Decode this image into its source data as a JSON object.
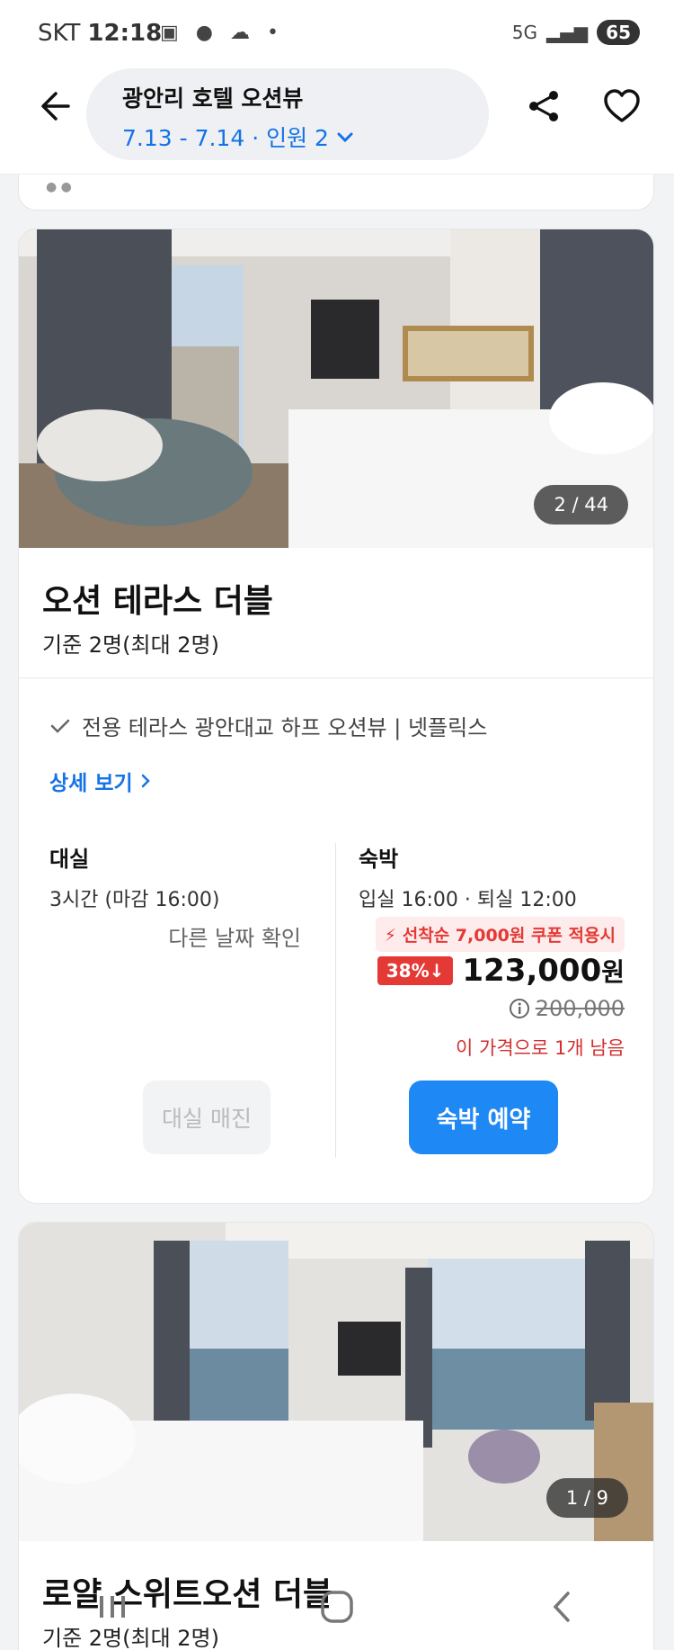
{
  "status_bar": {
    "carrier": "SKT",
    "time": "12:18",
    "network": "5G",
    "battery": "65"
  },
  "header": {
    "title": "광안리 호텔 오션뷰",
    "subtitle": "7.13 - 7.14 · 인원 2"
  },
  "rooms": [
    {
      "name": "오션 테라스 더블",
      "capacity": "기준 2명(최대 2명)",
      "photo_counter": "2 / 44",
      "amenities": "전용 테라스 광안대교 하프 오션뷰 | 넷플릭스",
      "detail_link": "상세 보기",
      "dayuse": {
        "title": "대실",
        "info": "3시간 (마감 16:00)",
        "other_date": "다른 날짜 확인",
        "button": "대실 매진"
      },
      "stay": {
        "title": "숙박",
        "info": "입실 16:00 · 퇴실 12:00",
        "coupon": "선착순 7,000원 쿠폰 적용시",
        "discount": "38%",
        "price": "123,000",
        "price_unit": "원",
        "original_price": "200,000",
        "remaining": "이 가격으로 1개 남음",
        "button": "숙박 예약"
      }
    },
    {
      "name": "로얄 스위트오션 더블",
      "capacity": "기준 2명(최대 2명)",
      "photo_counter": "1 / 9"
    }
  ],
  "colors": {
    "accent": "#1473e6",
    "book_button": "#1e88f5",
    "discount_red": "#e53935"
  },
  "icons": [
    "back-arrow-icon",
    "chevron-down-icon",
    "share-icon",
    "heart-icon",
    "check-icon",
    "chevron-right-icon",
    "lightning-icon",
    "arrow-down-icon",
    "info-icon"
  ]
}
